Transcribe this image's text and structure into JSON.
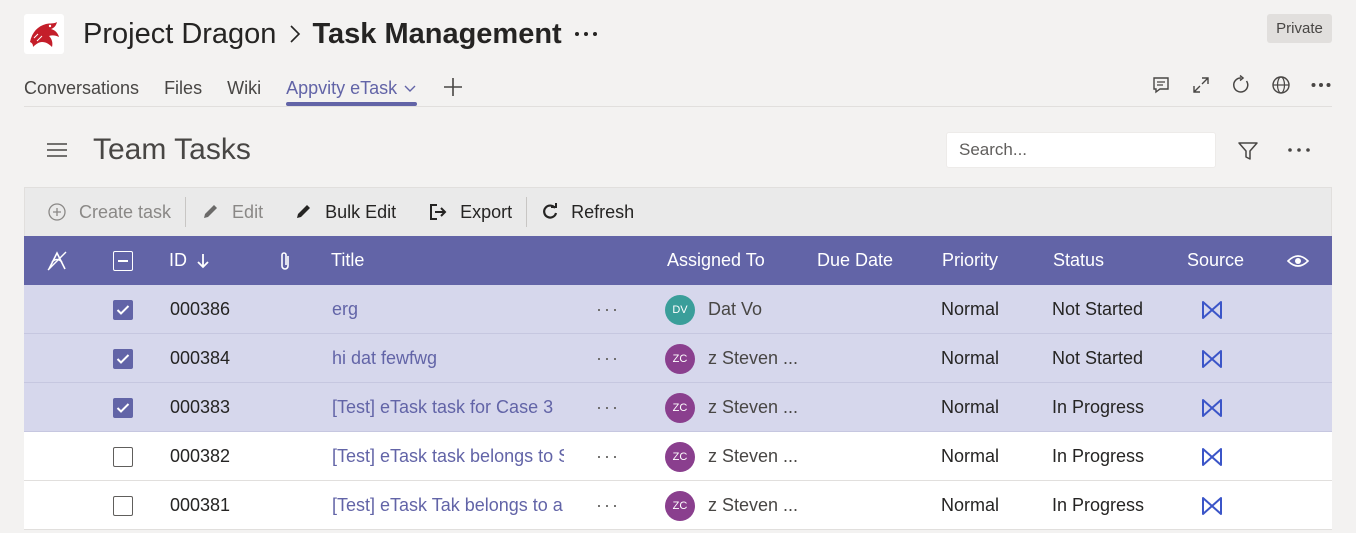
{
  "header": {
    "team": "Project Dragon",
    "page": "Task Management",
    "privacy": "Private"
  },
  "tabs": [
    {
      "label": "Conversations",
      "active": false
    },
    {
      "label": "Files",
      "active": false
    },
    {
      "label": "Wiki",
      "active": false
    },
    {
      "label": "Appvity eTask",
      "active": true
    }
  ],
  "tab_icons": [
    "chat-icon",
    "expand-icon",
    "refresh-icon",
    "globe-icon",
    "more-icon"
  ],
  "app": {
    "title": "Team Tasks",
    "search_placeholder": "Search..."
  },
  "toolbar": {
    "create": "Create task",
    "edit": "Edit",
    "bulk_edit": "Bulk Edit",
    "export": "Export",
    "refresh": "Refresh"
  },
  "columns": {
    "id": "ID",
    "title": "Title",
    "assigned": "Assigned To",
    "due": "Due Date",
    "priority": "Priority",
    "status": "Status",
    "source": "Source"
  },
  "rows": [
    {
      "selected": true,
      "id": "000386",
      "title": "erg",
      "initials": "DV",
      "avatar_color": "#3a9e9a",
      "assigned": "Dat Vo",
      "due": "",
      "priority": "Normal",
      "status": "Not Started"
    },
    {
      "selected": true,
      "id": "000384",
      "title": "hi dat fewfwg",
      "initials": "ZC",
      "avatar_color": "#8a3f8e",
      "assigned": "z Steven ...",
      "due": "",
      "priority": "Normal",
      "status": "Not Started"
    },
    {
      "selected": true,
      "id": "000383",
      "title": "[Test] eTask task for Case 3",
      "initials": "ZC",
      "avatar_color": "#8a3f8e",
      "assigned": "z Steven ...",
      "due": "",
      "priority": "Normal",
      "status": "In Progress"
    },
    {
      "selected": false,
      "id": "000382",
      "title": "[Test] eTask task belongs to S..",
      "initials": "ZC",
      "avatar_color": "#8a3f8e",
      "assigned": "z Steven ...",
      "due": "",
      "priority": "Normal",
      "status": "In Progress"
    },
    {
      "selected": false,
      "id": "000381",
      "title": "[Test] eTask Tak belongs to a ..",
      "initials": "ZC",
      "avatar_color": "#8a3f8e",
      "assigned": "z Steven ...",
      "due": "",
      "priority": "Normal",
      "status": "In Progress"
    }
  ],
  "colors": {
    "accent": "#6264a7",
    "selected_row": "#d6d7ec",
    "source_icon": "#3b55c8"
  }
}
